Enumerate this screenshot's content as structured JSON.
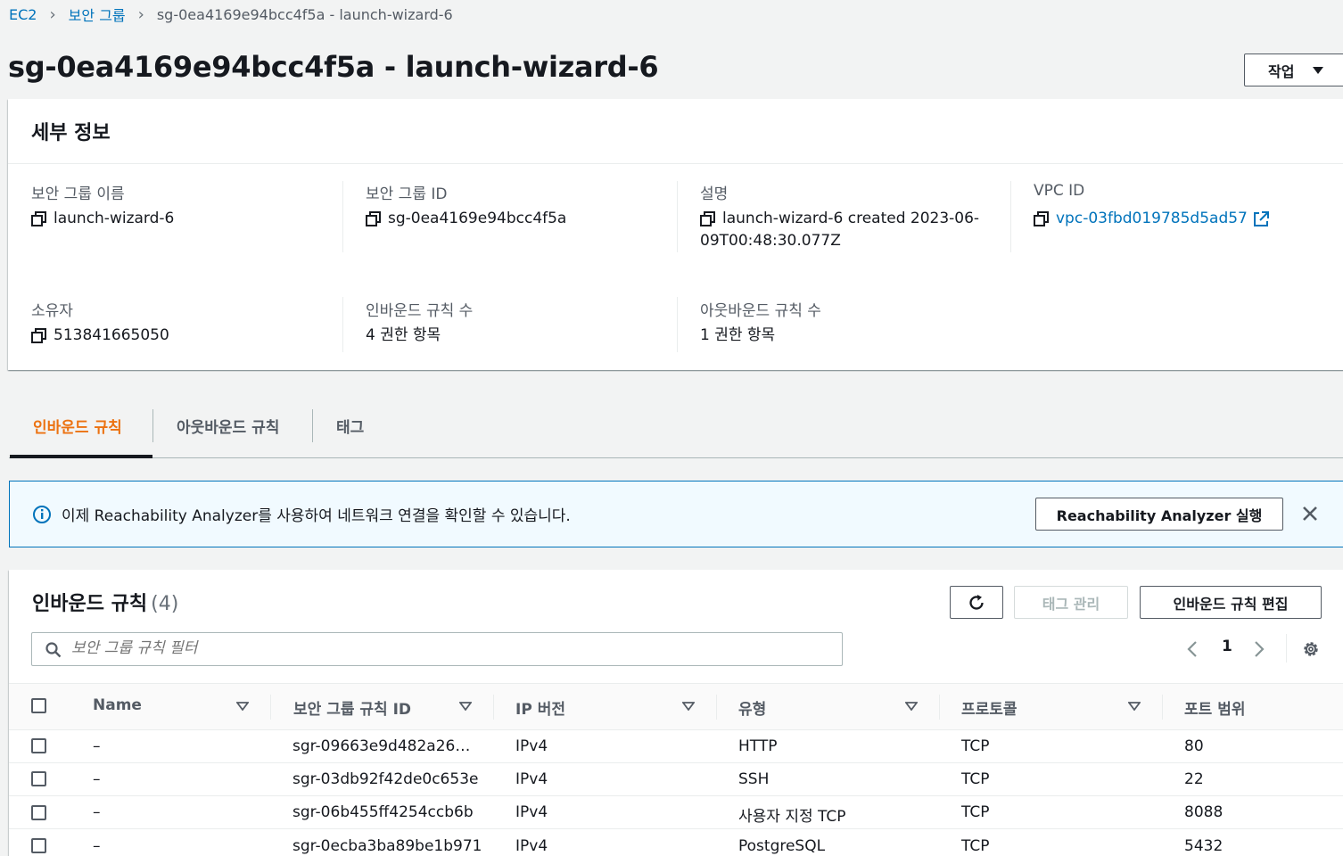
{
  "breadcrumb": {
    "items": [
      {
        "label": "EC2"
      },
      {
        "label": "보안 그룹"
      },
      {
        "label": "sg-0ea4169e94bcc4f5a - launch-wizard-6"
      }
    ]
  },
  "page": {
    "title": "sg-0ea4169e94bcc4f5a - launch-wizard-6",
    "actions_label": "작업"
  },
  "details": {
    "title": "세부 정보",
    "fields": {
      "sg_name": {
        "label": "보안 그룹 이름",
        "value": "launch-wizard-6"
      },
      "sg_id": {
        "label": "보안 그룹 ID",
        "value": "sg-0ea4169e94bcc4f5a"
      },
      "description": {
        "label": "설명",
        "value_line1": "launch-wizard-6 created 2023-06-",
        "value_line2": "09T00:48:30.077Z"
      },
      "vpc_id": {
        "label": "VPC ID",
        "value": "vpc-03fbd019785d5ad57"
      },
      "owner": {
        "label": "소유자",
        "value": "513841665050"
      },
      "inbound_count": {
        "label": "인바운드 규칙 수",
        "value": "4 권한 항목"
      },
      "outbound_count": {
        "label": "아웃바운드 규칙 수",
        "value": "1 권한 항목"
      }
    }
  },
  "tabs": [
    {
      "label": "인바운드 규칙",
      "active": true
    },
    {
      "label": "아웃바운드 규칙",
      "active": false
    },
    {
      "label": "태그",
      "active": false
    }
  ],
  "alert": {
    "text": "이제 Reachability Analyzer를 사용하여 네트워크 연결을 확인할 수 있습니다.",
    "button_label": "Reachability Analyzer 실행"
  },
  "rules": {
    "title": "인바운드 규칙",
    "count": "(4)",
    "manage_tags_label": "태그 관리",
    "edit_label": "인바운드 규칙 편집",
    "search_placeholder": "보안 그룹 규칙 필터",
    "page_number": "1",
    "columns": [
      "Name",
      "보안 그룹 규칙 ID",
      "IP 버전",
      "유형",
      "프로토콜",
      "포트 범위"
    ],
    "rows": [
      {
        "name": "–",
        "rule_id": "sgr-09663e9d482a26…",
        "ip_version": "IPv4",
        "type": "HTTP",
        "protocol": "TCP",
        "port": "80"
      },
      {
        "name": "–",
        "rule_id": "sgr-03db92f42de0c653e",
        "ip_version": "IPv4",
        "type": "SSH",
        "protocol": "TCP",
        "port": "22"
      },
      {
        "name": "–",
        "rule_id": "sgr-06b455ff4254ccb6b",
        "ip_version": "IPv4",
        "type": "사용자 지정 TCP",
        "protocol": "TCP",
        "port": "8088"
      },
      {
        "name": "–",
        "rule_id": "sgr-0ecba3ba89be1b971",
        "ip_version": "IPv4",
        "type": "PostgreSQL",
        "protocol": "TCP",
        "port": "5432"
      }
    ]
  },
  "colors": {
    "link": "#0073bb",
    "active_tab": "#ec7211",
    "alert_bg": "#f1faff"
  }
}
